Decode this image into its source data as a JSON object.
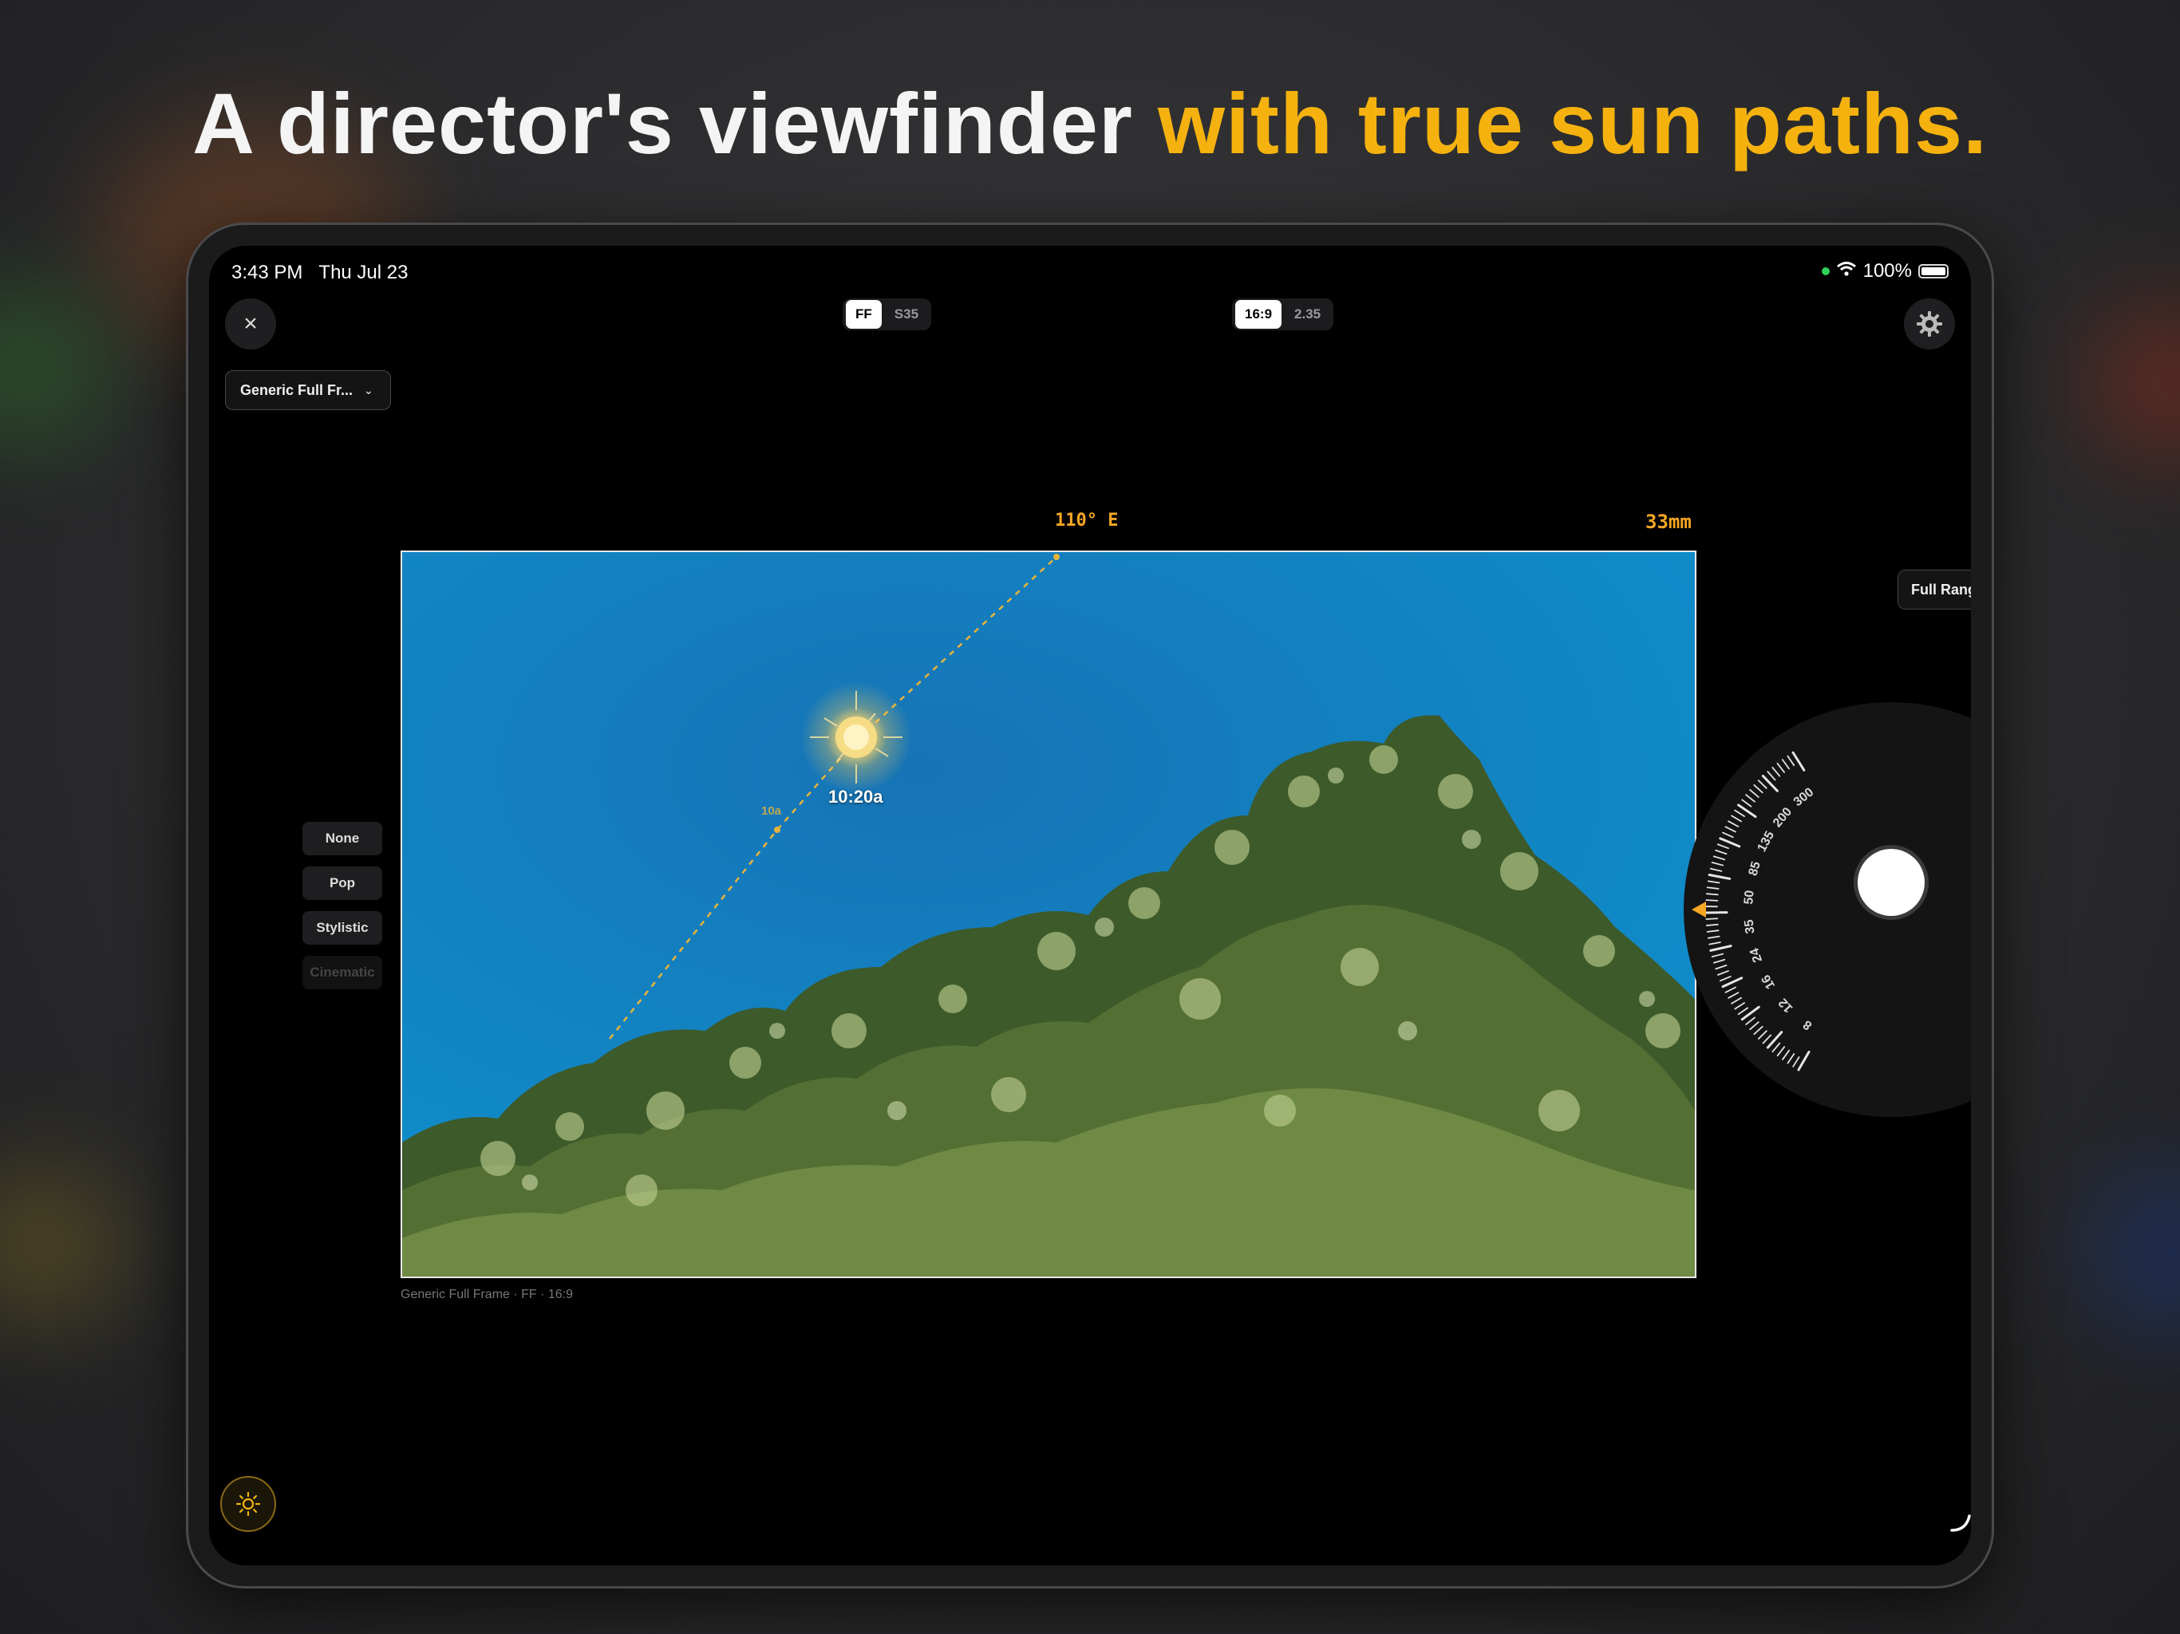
{
  "headline": {
    "white": "A director's viewfinder ",
    "accent": "with true sun paths."
  },
  "status": {
    "time": "3:43 PM",
    "date": "Thu Jul 23",
    "battery": "100%"
  },
  "toolbar": {
    "close_icon": "×",
    "sensor_options": [
      "FF",
      "S35"
    ],
    "sensor_selected": "FF",
    "aspect_options": [
      "16:9",
      "2.35"
    ],
    "aspect_selected": "16:9",
    "settings_icon": "gear-icon"
  },
  "camera_select": {
    "label": "Generic Full Fr...",
    "chevron": "⌄"
  },
  "range_select": {
    "label": "Full Range",
    "chevron": "⌄"
  },
  "readouts": {
    "heading": "110° E",
    "focal": "33mm"
  },
  "sun": {
    "time_label": "10:20a",
    "hour_marker": "10a"
  },
  "frame_caption": "Generic Full Frame · FF · 16:9",
  "look_presets": [
    {
      "label": "None",
      "enabled": true
    },
    {
      "label": "Pop",
      "enabled": true
    },
    {
      "label": "Stylistic",
      "enabled": true
    },
    {
      "label": "Cinematic",
      "enabled": false
    }
  ],
  "focal_dial": {
    "labels": [
      "8",
      "12",
      "16",
      "24",
      "35",
      "50",
      "85",
      "135",
      "200",
      "300"
    ]
  },
  "colors": {
    "accent": "#f5b20e",
    "readout": "#f5a623",
    "sky": "#1480c2"
  }
}
